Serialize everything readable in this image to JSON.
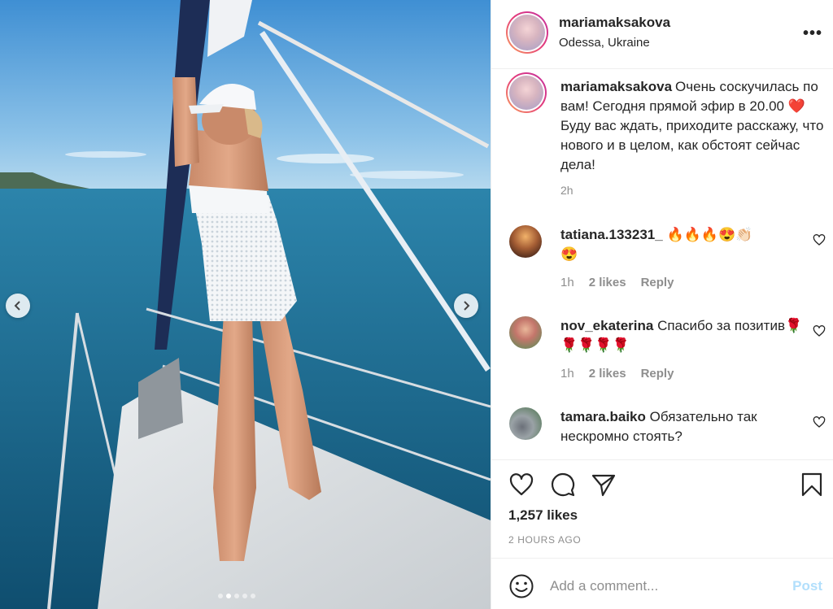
{
  "post": {
    "username": "mariamaksakova",
    "location": "Odessa, Ukraine",
    "more_icon": "more-horizontal-icon"
  },
  "caption": {
    "username": "mariamaksakova",
    "text_part1": "Очень соскучилась по вам! Сегодня прямой эфир в 20.00 ",
    "heart_emoji": "❤️",
    "text_part2": " Буду вас ждать, приходите расскажу, что нового и в целом, как обстоят сейчас дела!",
    "time": "2h"
  },
  "comments": [
    {
      "username": "tatiana.133231_",
      "text": "🔥🔥🔥😍👏🏻",
      "text_line2": "😍",
      "time": "1h",
      "likes": "2 likes",
      "reply": "Reply"
    },
    {
      "username": "nov_ekaterina",
      "text": "Спасибо за позитив🌹🌹🌹🌹🌹",
      "time": "1h",
      "likes": "2 likes",
      "reply": "Reply"
    },
    {
      "username": "tamara.baiko",
      "text": "Обязательно так нескромно стоять?"
    }
  ],
  "actions": {
    "likes": "1,257 likes",
    "time_ago": "2 HOURS AGO"
  },
  "add_comment": {
    "placeholder": "Add a comment...",
    "post_label": "Post"
  },
  "carousel": {
    "slide_count": 5,
    "active_index": 1
  },
  "colors": {
    "text": "#262626",
    "secondary": "#8e8e8e",
    "post_disabled": "#b2dffc",
    "sea": "#1f6e93",
    "sky": "#5aa9de"
  }
}
